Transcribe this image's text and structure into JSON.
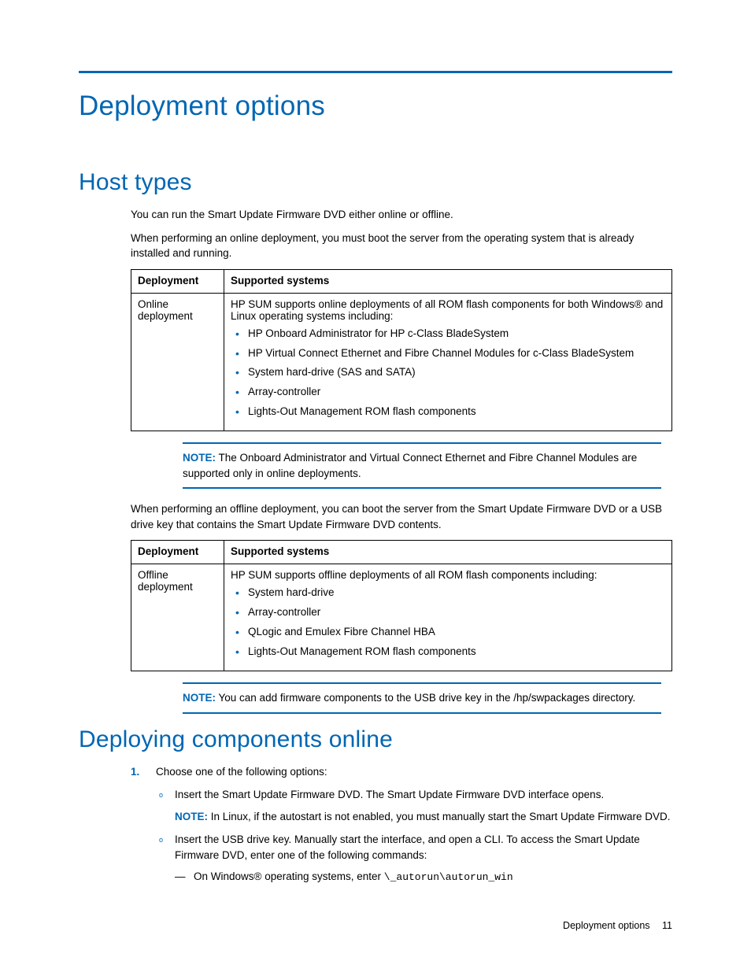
{
  "chapter_title": "Deployment options",
  "section1": {
    "title": "Host types",
    "para1": "You can run the Smart Update Firmware DVD either online or offline.",
    "para2": "When performing an online deployment, you must boot the server from the operating system that is already installed and running.",
    "table1": {
      "header_col1": "Deployment",
      "header_col2": "Supported systems",
      "row1_col1": "Online deployment",
      "row1_intro": "HP SUM supports online deployments of all ROM flash components for both Windows® and Linux operating systems including:",
      "row1_items": [
        "HP Onboard Administrator for HP c-Class BladeSystem",
        "HP Virtual Connect Ethernet and Fibre Channel Modules for c-Class BladeSystem",
        "System hard-drive (SAS and SATA)",
        "Array-controller",
        "Lights-Out Management ROM flash components"
      ]
    },
    "note1_label": "NOTE:",
    "note1_text": " The Onboard Administrator and Virtual Connect Ethernet and Fibre Channel Modules are supported only in online deployments.",
    "para3": "When performing an offline deployment, you can boot the server from the Smart Update Firmware DVD or a USB drive key that contains the Smart Update Firmware DVD contents.",
    "table2": {
      "header_col1": "Deployment",
      "header_col2": "Supported systems",
      "row1_col1": "Offline deployment",
      "row1_intro": "HP SUM supports offline deployments of all ROM flash components including:",
      "row1_items": [
        "System hard-drive",
        "Array-controller",
        "QLogic and Emulex Fibre Channel HBA",
        "Lights-Out Management ROM flash components"
      ]
    },
    "note2_label": "NOTE:",
    "note2_text": " You can add firmware components to the USB drive key in the /hp/swpackages directory."
  },
  "section2": {
    "title": "Deploying components online",
    "step1_num": "1.",
    "step1_text": "Choose one of the following options:",
    "option_a": "Insert the Smart Update Firmware DVD. The Smart Update Firmware DVD interface opens.",
    "option_a_note_label": "NOTE:",
    "option_a_note_text": " In Linux, if the autostart is not enabled, you must manually start the Smart Update Firmware DVD.",
    "option_b": "Insert the USB drive key. Manually start the interface, and open a CLI. To access the Smart Update Firmware DVD, enter one of the following commands:",
    "option_b_dash_prefix": "On Windows® operating systems, enter ",
    "option_b_dash_cmd": "\\_autorun\\autorun_win"
  },
  "footer": {
    "section": "Deployment options",
    "page": "11"
  }
}
